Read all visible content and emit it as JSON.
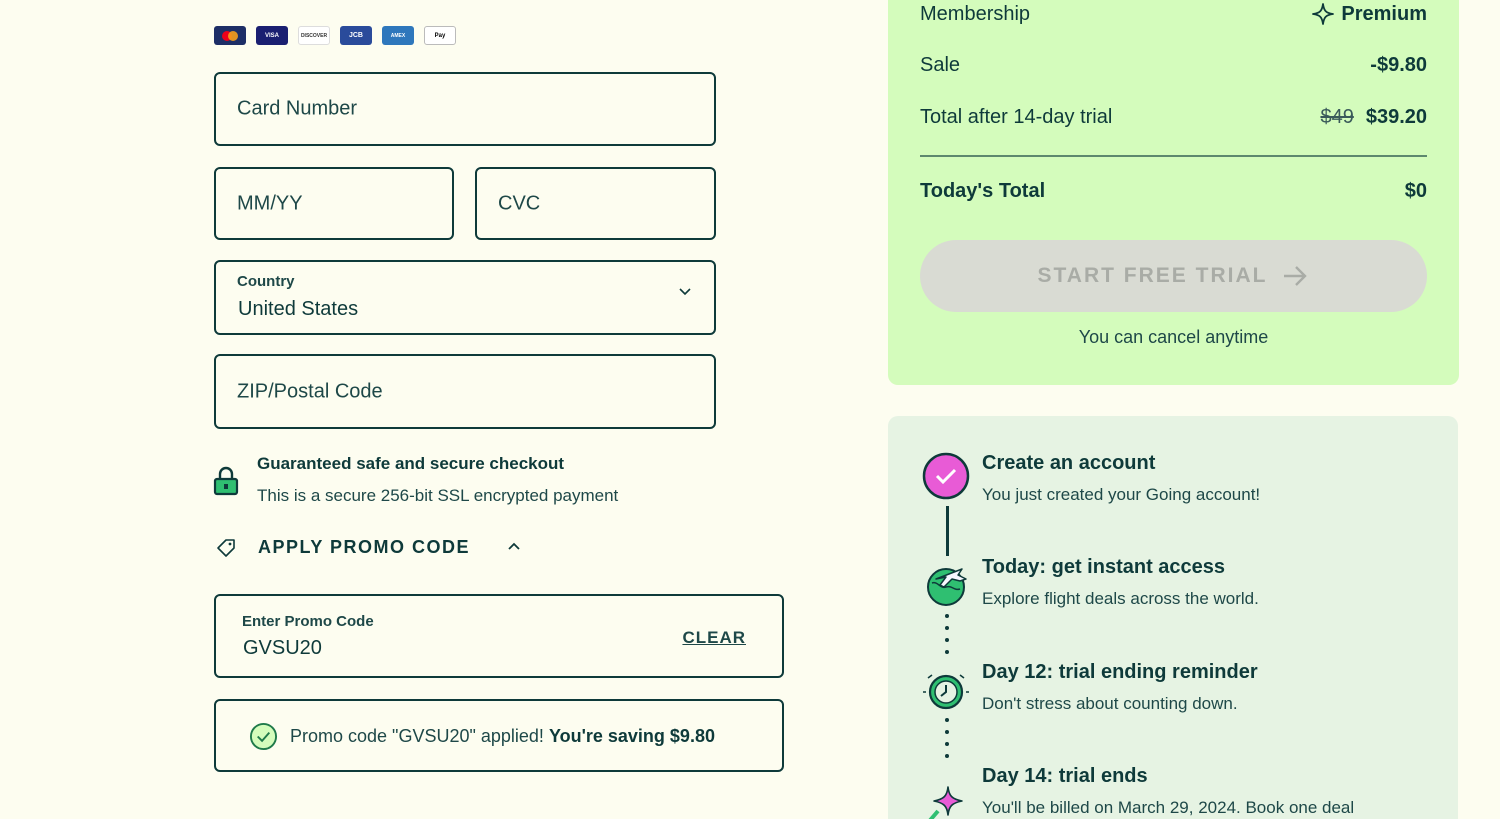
{
  "payment_cards": [
    "mastercard-icon",
    "visa-icon",
    "discover-icon",
    "jcb-icon",
    "amex-icon",
    "apple-pay-icon"
  ],
  "card_labels": {
    "visa": "VISA",
    "discover": "DISCOVER",
    "jcb": "JCB",
    "amex": "AMEX",
    "apay": "Pay"
  },
  "form": {
    "card_number_placeholder": "Card Number",
    "expiry_placeholder": "MM/YY",
    "cvc_placeholder": "CVC",
    "country_label": "Country",
    "country_value": "United States",
    "zip_placeholder": "ZIP/Postal Code"
  },
  "secure": {
    "title": "Guaranteed safe and secure checkout",
    "subtitle": "This is a secure 256-bit SSL encrypted payment"
  },
  "promo": {
    "toggle_label": "APPLY PROMO CODE",
    "field_label": "Enter Promo Code",
    "field_value": "GVSU20",
    "clear_label": "CLEAR",
    "applied_text": "Promo code \"GVSU20\" applied!",
    "applied_saving": "You're saving $9.80"
  },
  "summary": {
    "membership_label": "Membership",
    "membership_value": "Premium",
    "sale_label": "Sale",
    "sale_value": "-$9.80",
    "total_after_label": "Total after 14-day trial",
    "total_after_old": "$49",
    "total_after_new": "$39.20",
    "today_label": "Today's Total",
    "today_value": "$0",
    "start_button": "START FREE TRIAL",
    "cancel_note": "You can cancel anytime"
  },
  "timeline": [
    {
      "title": "Create an account",
      "desc": "You just created your Going account!",
      "icon": "check-circle-icon"
    },
    {
      "title": "Today: get instant access",
      "desc": "Explore flight deals across the world.",
      "icon": "globe-plane-icon"
    },
    {
      "title": "Day 12: trial ending reminder",
      "desc": "Don't stress about counting down.",
      "icon": "alarm-clock-icon"
    },
    {
      "title": "Day 14: trial ends",
      "desc": "You'll be billed on March 29, 2024. Book one deal",
      "icon": "sparkle-wand-icon"
    }
  ],
  "colors": {
    "background": "#fdfdf0",
    "text": "#0e3a3a",
    "summary_bg": "#d4fcbc",
    "timeline_bg": "#e6f3e3",
    "accent_green": "#2fbf71",
    "accent_pink": "#e85bd6",
    "button_disabled": "#d9dbd3"
  }
}
